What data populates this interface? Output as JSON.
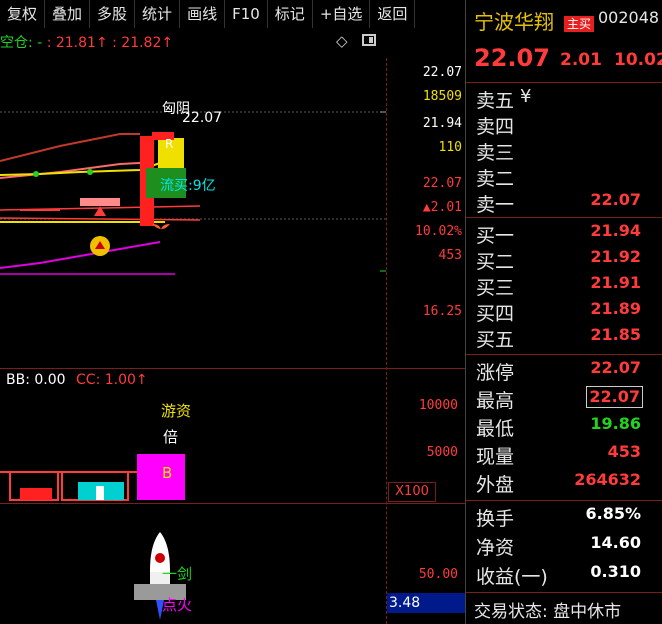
{
  "toolbar": {
    "items": [
      "复权",
      "叠加",
      "多股",
      "统计",
      "画线",
      "F10",
      "标记",
      "+自选",
      "返回"
    ]
  },
  "chart": {
    "position_label": "空仓:",
    "position_dash": "-",
    "price_a": ": 21.81",
    "price_b": ": 21.82",
    "arrow": "↑",
    "axis_labels": [
      "22.07",
      "18509",
      "21.94",
      "110",
      "22.07",
      "▲2.01",
      "10.02%",
      "453",
      "16.25"
    ],
    "annotations": {
      "yin": "匈阴",
      "price_tag": "22.07",
      "buy_flow": "流买:9亿",
      "r_mark": "R"
    },
    "lower": {
      "bb_label": "BB: 0.00",
      "cc_label": "CC: 1.00",
      "axis_labels": [
        "10000",
        "5000"
      ],
      "multiplier": "X100",
      "youzi": "游资",
      "bei": "倍",
      "b_mark": "B"
    },
    "bottom": {
      "axis_label": "50.00",
      "value_box": "3.48",
      "rocket_lines": [
        "一剑",
        "点火"
      ]
    }
  },
  "panel": {
    "stock_name": "宁波华翔",
    "badge": "主买",
    "code": "002048",
    "price": "22.07",
    "change": "2.01",
    "pct": "10.02",
    "sell_levels": [
      {
        "label": "卖五",
        "price": "",
        "extra": "¥"
      },
      {
        "label": "卖四",
        "price": ""
      },
      {
        "label": "卖三",
        "price": ""
      },
      {
        "label": "卖二",
        "price": ""
      },
      {
        "label": "卖一",
        "price": "22.07"
      }
    ],
    "buy_levels": [
      {
        "label": "买一",
        "price": "21.94"
      },
      {
        "label": "买二",
        "price": "21.92"
      },
      {
        "label": "买三",
        "price": "21.91"
      },
      {
        "label": "买四",
        "price": "21.89"
      },
      {
        "label": "买五",
        "price": "21.85"
      }
    ],
    "stats1": [
      {
        "label": "涨停",
        "value": "22.07",
        "color": "#ff3b3b"
      },
      {
        "label": "最高",
        "value": "22.07",
        "color": "#ff3b3b"
      },
      {
        "label": "最低",
        "value": "19.86",
        "color": "#22d322"
      },
      {
        "label": "现量",
        "value": "453",
        "color": "#ff3b3b"
      },
      {
        "label": "外盘",
        "value": "264632",
        "color": "#ff3b3b"
      }
    ],
    "stats2": [
      {
        "label": "换手",
        "value": "6.85%",
        "color": "#e6e6e6"
      },
      {
        "label": "净资",
        "value": "14.60",
        "color": "#e6e6e6"
      },
      {
        "label": "收益(一)",
        "value": "0.310",
        "color": "#e6e6e6"
      }
    ],
    "status": "交易状态: 盘中休市"
  }
}
